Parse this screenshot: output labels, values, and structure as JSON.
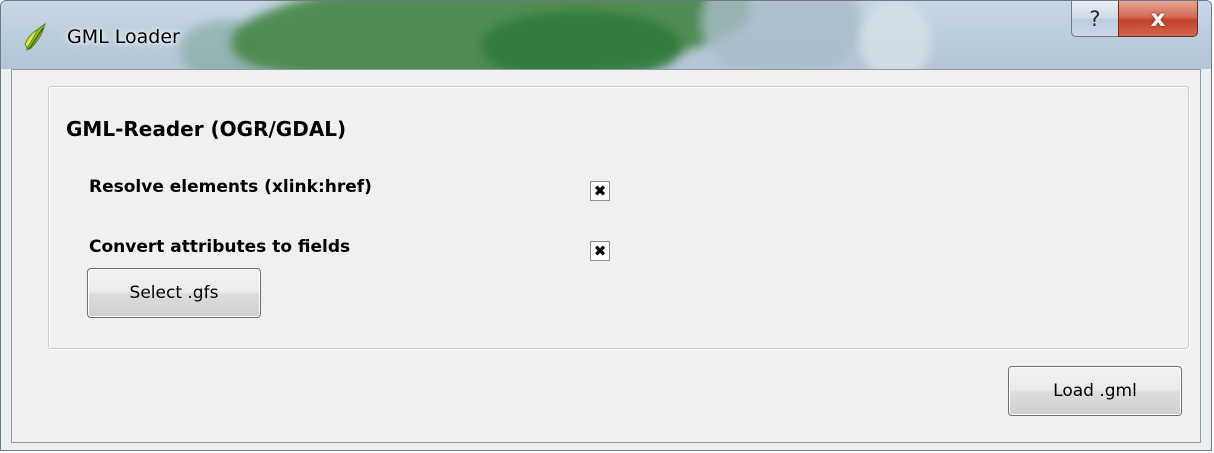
{
  "window": {
    "title": "GML Loader",
    "app_icon": "qgis-icon",
    "help_label": "?",
    "close_label": "x"
  },
  "group": {
    "title": "GML-Reader (OGR/GDAL)",
    "options": [
      {
        "label": "Resolve elements (xlink:href)",
        "checked": true,
        "mark": "✖"
      },
      {
        "label": "Convert attributes to fields",
        "checked": true,
        "mark": "✖"
      }
    ],
    "select_button_label": "Select .gfs"
  },
  "footer": {
    "load_button_label": "Load .gml"
  },
  "colors": {
    "client_bg": "#f0f0f0",
    "close_red": "#c3432b",
    "qgis_green": "#8fbf2a"
  }
}
